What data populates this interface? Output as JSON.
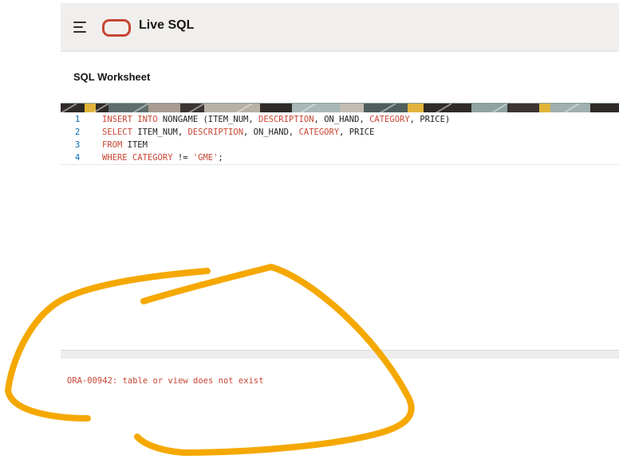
{
  "header": {
    "menu_icon": "hamburger-menu-icon",
    "logo_icon": "oracle-logo-icon",
    "logo_color": "#c74634",
    "app_title": "Live SQL"
  },
  "worksheet": {
    "title": "SQL Worksheet"
  },
  "editor": {
    "lines": [
      {
        "num": "1",
        "tokens": [
          {
            "t": "INSERT",
            "k": "kw"
          },
          {
            "t": " "
          },
          {
            "t": "INTO",
            "k": "kw"
          },
          {
            "t": " NONGAME (ITEM_NUM, "
          },
          {
            "t": "DESCRIPTION",
            "k": "kw"
          },
          {
            "t": ", ON_HAND, "
          },
          {
            "t": "CATEGORY",
            "k": "kw"
          },
          {
            "t": ", PRICE)"
          }
        ]
      },
      {
        "num": "2",
        "tokens": [
          {
            "t": "SELECT",
            "k": "kw"
          },
          {
            "t": " ITEM_NUM, "
          },
          {
            "t": "DESCRIPTION",
            "k": "kw"
          },
          {
            "t": ", ON_HAND, "
          },
          {
            "t": "CATEGORY",
            "k": "kw"
          },
          {
            "t": ", PRICE"
          }
        ]
      },
      {
        "num": "3",
        "tokens": [
          {
            "t": "FROM",
            "k": "kw"
          },
          {
            "t": " ITEM"
          }
        ]
      },
      {
        "num": "4",
        "tokens": [
          {
            "t": "WHERE",
            "k": "kw"
          },
          {
            "t": " "
          },
          {
            "t": "CATEGORY",
            "k": "kw"
          },
          {
            "t": " != "
          },
          {
            "t": "'GME'",
            "k": "str"
          },
          {
            "t": ";"
          }
        ]
      }
    ]
  },
  "results": {
    "error_message": "ORA-00942: table or view does not exist"
  },
  "annotation": {
    "color": "#f5a800"
  }
}
